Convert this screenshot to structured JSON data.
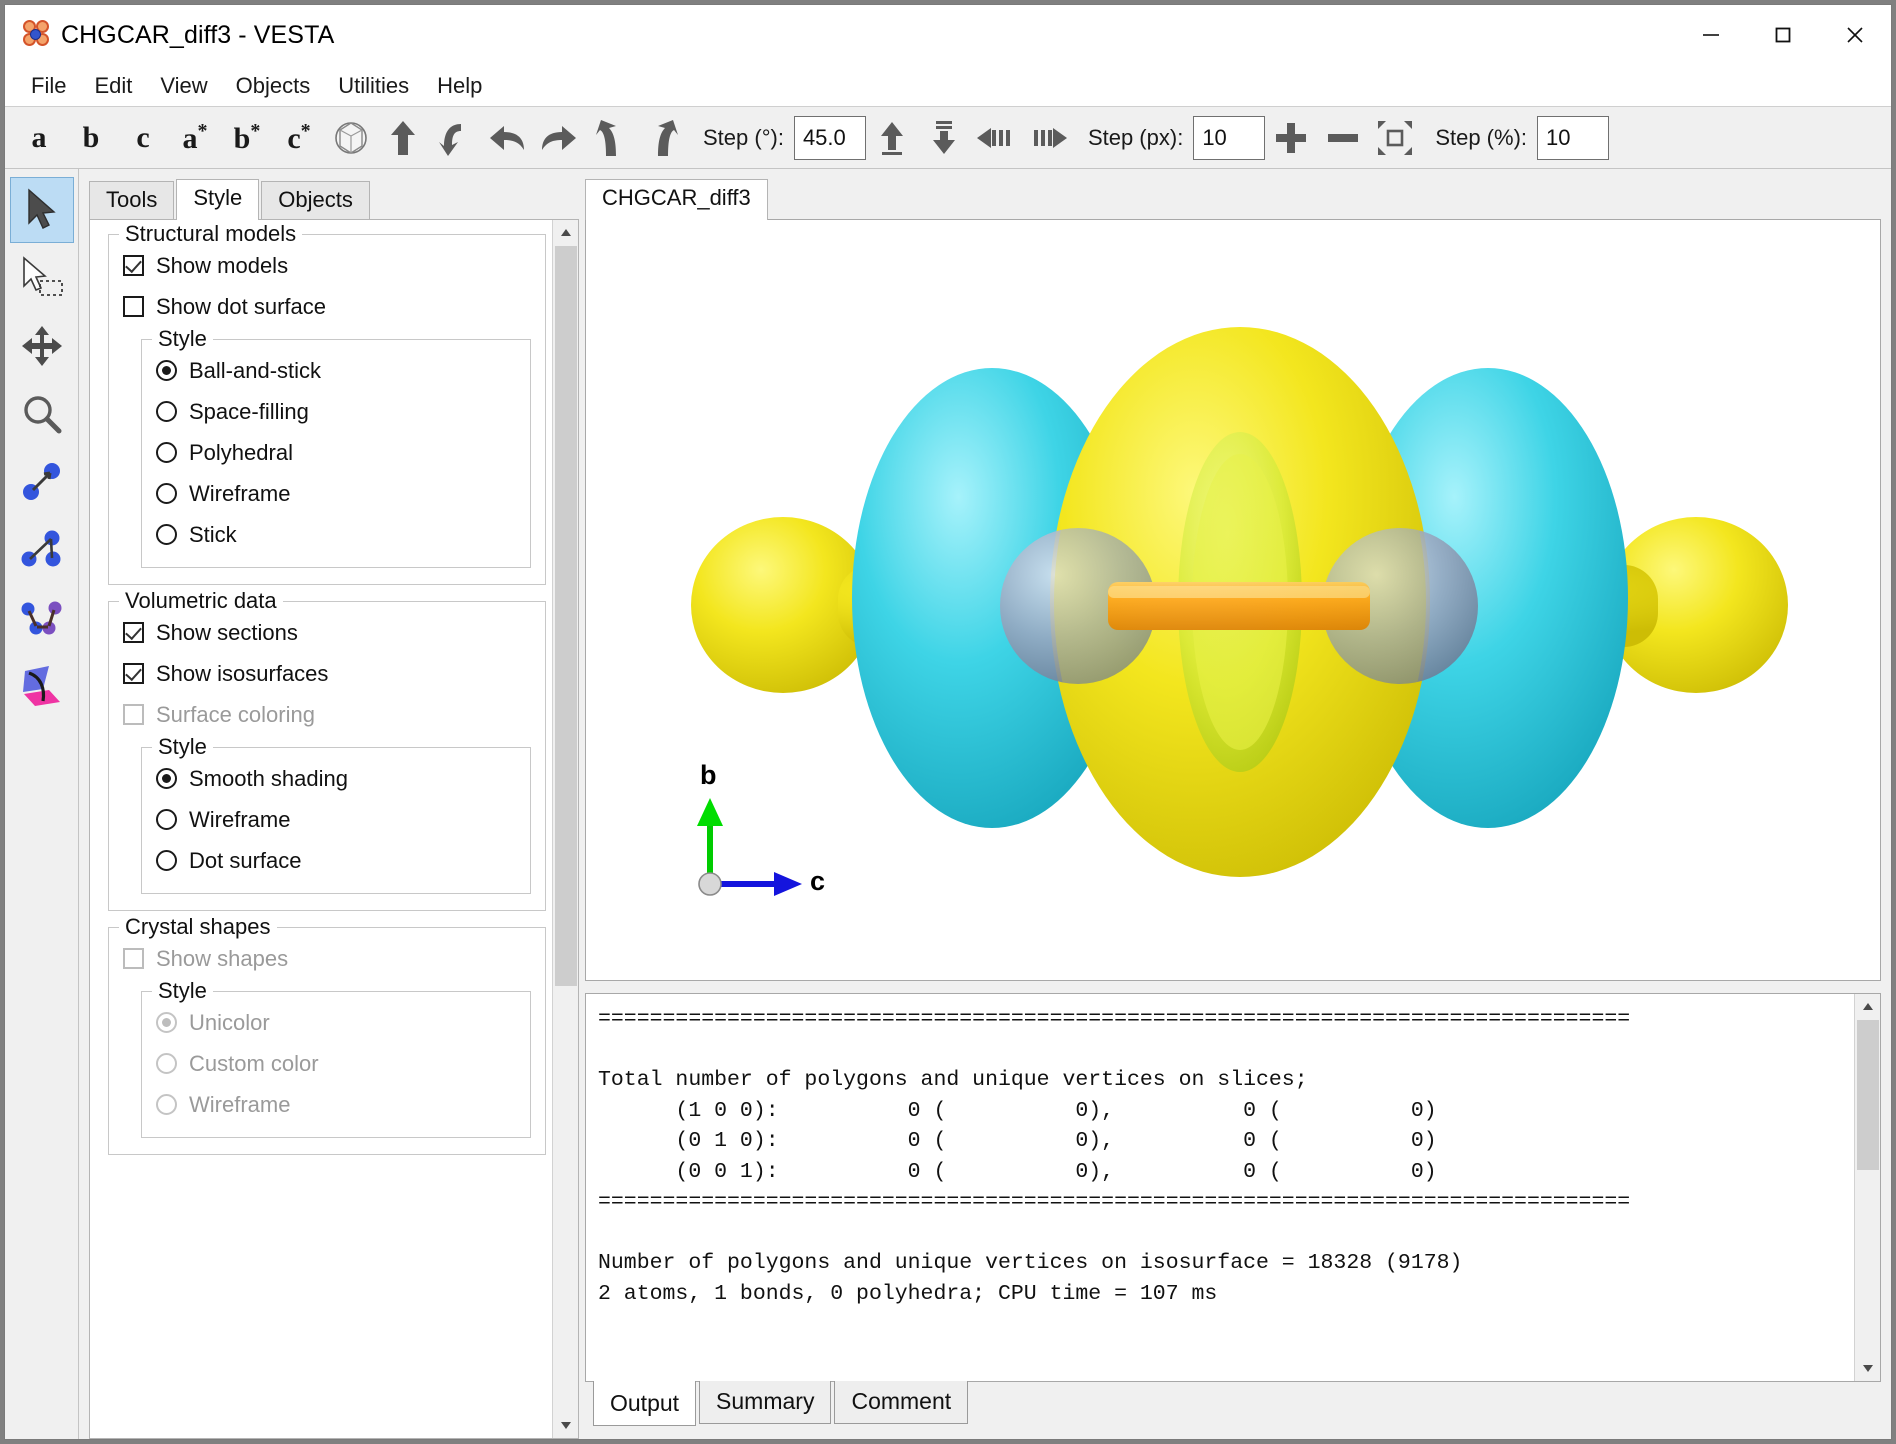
{
  "window": {
    "title": "CHGCAR_diff3 - VESTA",
    "app_icon": "vesta-molecule-icon",
    "controls": [
      {
        "name": "minimize-button",
        "glyph": "—"
      },
      {
        "name": "maximize-button",
        "glyph": "□"
      },
      {
        "name": "close-button",
        "glyph": "✕"
      }
    ]
  },
  "menubar": {
    "items": [
      {
        "label": "File"
      },
      {
        "label": "Edit"
      },
      {
        "label": "View"
      },
      {
        "label": "Objects"
      },
      {
        "label": "Utilities"
      },
      {
        "label": "Help"
      }
    ]
  },
  "toolbar": {
    "axis_buttons": [
      {
        "label": "a",
        "star": ""
      },
      {
        "label": "b",
        "star": ""
      },
      {
        "label": "c",
        "star": ""
      },
      {
        "label": "a",
        "star": "*"
      },
      {
        "label": "b",
        "star": "*"
      },
      {
        "label": "c",
        "star": "*"
      }
    ],
    "step_deg_label": "Step (°):",
    "step_deg_value": "45.0",
    "step_px_label": "Step (px):",
    "step_px_value": "10",
    "step_pct_label": "Step (%):",
    "step_pct_value": "10"
  },
  "left_toolbar": {
    "items": [
      {
        "name": "select-tool",
        "active": true
      },
      {
        "name": "rectangle-select-tool",
        "active": false
      },
      {
        "name": "pan-tool",
        "active": false
      },
      {
        "name": "zoom-tool",
        "active": false
      },
      {
        "name": "distance-tool",
        "active": false
      },
      {
        "name": "angle-tool",
        "active": false
      },
      {
        "name": "torsion-tool",
        "active": false
      },
      {
        "name": "plane-tool",
        "active": false
      }
    ]
  },
  "sidepanel": {
    "tabs": [
      {
        "label": "Tools",
        "active": false
      },
      {
        "label": "Style",
        "active": true
      },
      {
        "label": "Objects",
        "active": false
      }
    ],
    "structural_models": {
      "legend": "Structural models",
      "show_models": {
        "label": "Show models",
        "checked": true,
        "disabled": false
      },
      "show_dot_surface": {
        "label": "Show dot surface",
        "checked": false,
        "disabled": false
      },
      "style_legend": "Style",
      "style_options": [
        {
          "label": "Ball-and-stick",
          "selected": true,
          "disabled": false
        },
        {
          "label": "Space-filling",
          "selected": false,
          "disabled": false
        },
        {
          "label": "Polyhedral",
          "selected": false,
          "disabled": false
        },
        {
          "label": "Wireframe",
          "selected": false,
          "disabled": false
        },
        {
          "label": "Stick",
          "selected": false,
          "disabled": false
        }
      ]
    },
    "volumetric_data": {
      "legend": "Volumetric data",
      "show_sections": {
        "label": "Show sections",
        "checked": true,
        "disabled": false
      },
      "show_isosurfaces": {
        "label": "Show isosurfaces",
        "checked": true,
        "disabled": false
      },
      "surface_coloring": {
        "label": "Surface coloring",
        "checked": false,
        "disabled": true
      },
      "style_legend": "Style",
      "style_options": [
        {
          "label": "Smooth shading",
          "selected": true,
          "disabled": false
        },
        {
          "label": "Wireframe",
          "selected": false,
          "disabled": false
        },
        {
          "label": "Dot surface",
          "selected": false,
          "disabled": false
        }
      ]
    },
    "crystal_shapes": {
      "legend": "Crystal shapes",
      "show_shapes": {
        "label": "Show shapes",
        "checked": false,
        "disabled": true
      },
      "style_legend": "Style",
      "style_options": [
        {
          "label": "Unicolor",
          "selected": true,
          "disabled": true
        },
        {
          "label": "Custom color",
          "selected": false,
          "disabled": true
        },
        {
          "label": "Wireframe",
          "selected": false,
          "disabled": true
        }
      ]
    }
  },
  "viewport": {
    "tab_label": "CHGCAR_diff3",
    "axes": {
      "b_label": "b",
      "b_color": "#00dd00",
      "c_label": "c",
      "c_color": "#1414dd"
    },
    "isosurface_colors": {
      "positive": "#f2e61c",
      "negative": "#33d4e0",
      "bond": "#ff9a1e",
      "atom": "#9aa7c0"
    }
  },
  "output": {
    "text": "================================================================================\n\nTotal number of polygons and unique vertices on slices;\n      (1 0 0):          0 (          0),          0 (          0)\n      (0 1 0):          0 (          0),          0 (          0)\n      (0 0 1):          0 (          0),          0 (          0)\n================================================================================\n\nNumber of polygons and unique vertices on isosurface = 18328 (9178)\n2 atoms, 1 bonds, 0 polyhedra; CPU time = 107 ms",
    "tabs": [
      {
        "label": "Output",
        "active": true
      },
      {
        "label": "Summary",
        "active": false
      },
      {
        "label": "Comment",
        "active": false
      }
    ]
  }
}
